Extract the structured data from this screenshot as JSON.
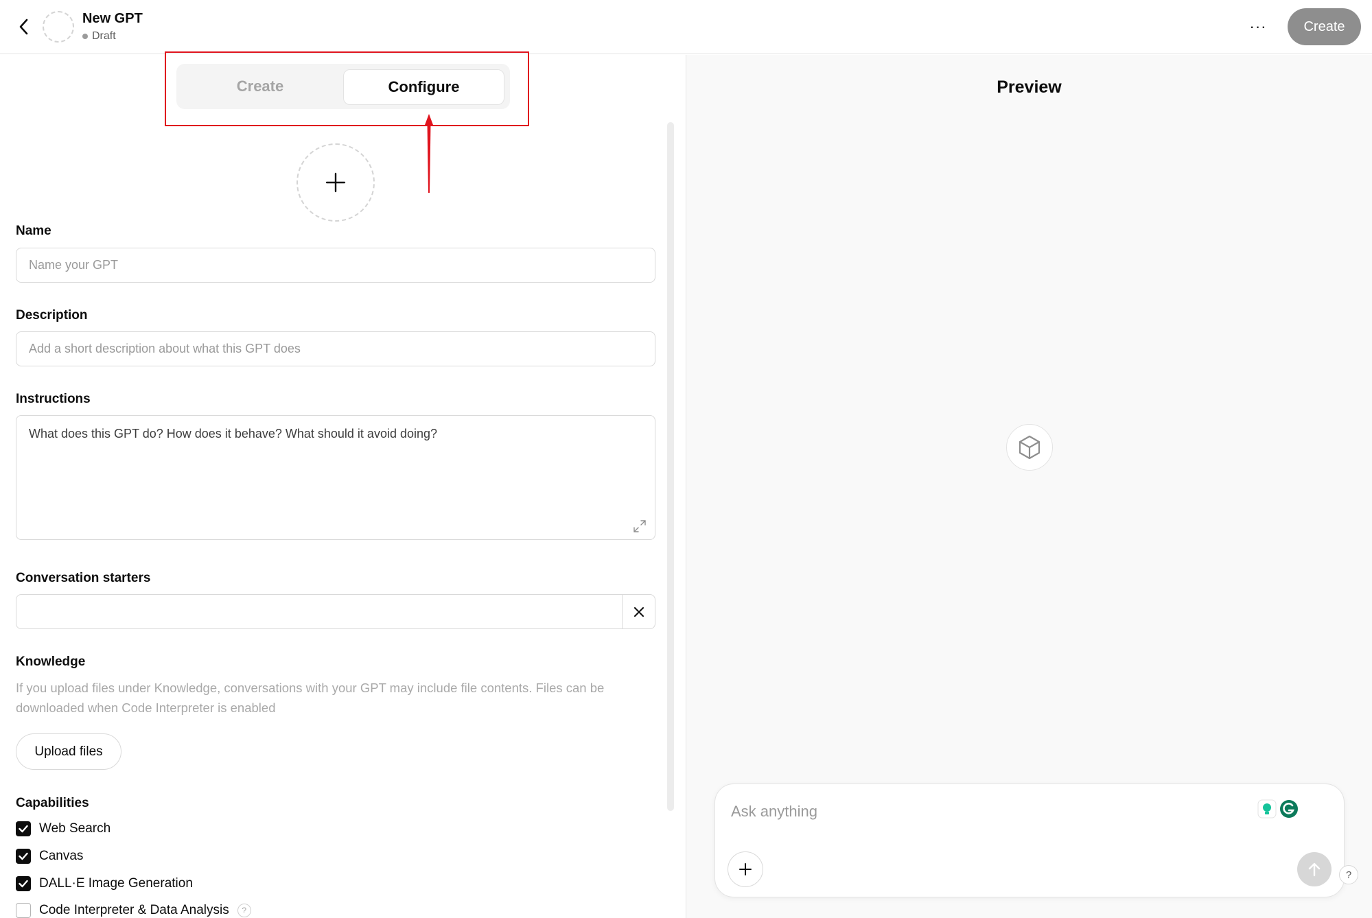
{
  "header": {
    "title": "New GPT",
    "status": "Draft",
    "create_label": "Create",
    "more_label": "···"
  },
  "tabs": {
    "create_label": "Create",
    "configure_label": "Configure",
    "active": "Configure"
  },
  "form": {
    "name": {
      "label": "Name",
      "value": "",
      "placeholder": "Name your GPT"
    },
    "description": {
      "label": "Description",
      "value": "",
      "placeholder": "Add a short description about what this GPT does"
    },
    "instructions": {
      "label": "Instructions",
      "value": "",
      "placeholder": "What does this GPT do? How does it behave? What should it avoid doing?"
    },
    "conversation_starters": {
      "label": "Conversation starters",
      "value": "",
      "placeholder": ""
    },
    "knowledge": {
      "label": "Knowledge",
      "help": "If you upload files under Knowledge, conversations with your GPT may include file contents. Files can be downloaded when Code Interpreter is enabled",
      "upload_label": "Upload files"
    },
    "capabilities": {
      "label": "Capabilities",
      "items": [
        {
          "label": "Web Search",
          "checked": true
        },
        {
          "label": "Canvas",
          "checked": true
        },
        {
          "label": "DALL·E Image Generation",
          "checked": true
        },
        {
          "label": "Code Interpreter & Data Analysis",
          "checked": false
        }
      ]
    }
  },
  "preview": {
    "title": "Preview",
    "composer_placeholder": "Ask anything",
    "help_label": "?"
  },
  "annotation": {
    "highlight_color": "#e0141e"
  },
  "colors": {
    "accent_dark": "#0d0d0d",
    "disabled_button": "#8e8e8e",
    "grammarly_green": "#15c39a"
  }
}
